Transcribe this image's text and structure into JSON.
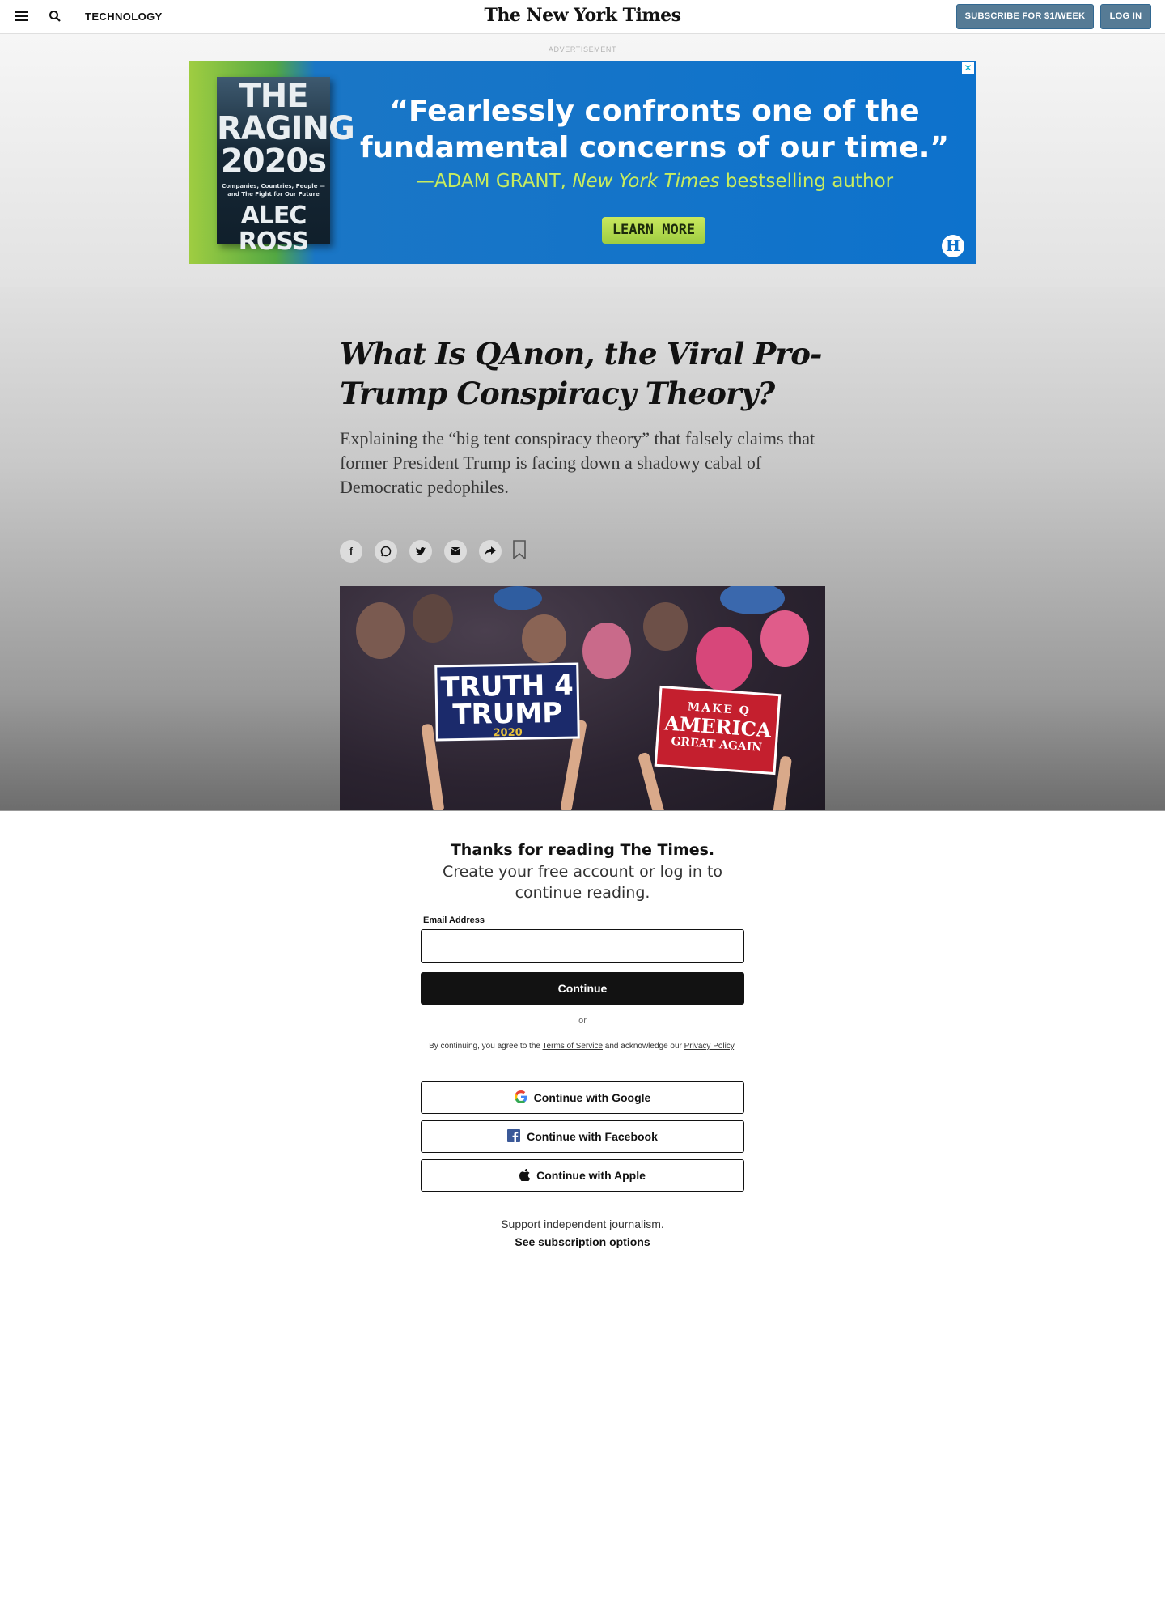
{
  "header": {
    "section": "TECHNOLOGY",
    "logo": "The New York Times",
    "subscribe_label": "SUBSCRIBE FOR $1/WEEK",
    "login_label": "LOG IN"
  },
  "ad": {
    "label": "ADVERTISEMENT",
    "book_title_1": "THE RAGING 2020s",
    "book_subtitle": "Companies, Countries, People — and The Fight for Our Future",
    "book_author": "ALEC ROSS",
    "quote": "“Fearlessly confronts one of the fundamental concerns of our time.”",
    "attribution_prefix": "—ADAM GRANT, ",
    "attribution_pub": "New York Times",
    "attribution_suffix": " bestselling author",
    "button": "LEARN MORE",
    "close": "✕",
    "publisher_mark": "H",
    "colors": {
      "blue": "#0d72cc",
      "green": "#9fcd41"
    }
  },
  "article": {
    "headline": "What Is QAnon, the Viral Pro-Trump Conspiracy Theory?",
    "summary": "Explaining the “big tent conspiracy theory” that falsely claims that former President Trump is facing down a shadowy cabal of Democratic pedophiles.",
    "share_icons": [
      "facebook-icon",
      "whatsapp-icon",
      "twitter-icon",
      "email-icon",
      "share-icon",
      "bookmark-icon"
    ],
    "photo": {
      "sign1_line1": "TRUTH 4",
      "sign1_line2": "TRUMP",
      "sign1_line3": "2020",
      "sign2_line1": "MAKE Q",
      "sign2_line2": "AMERICA",
      "sign2_line3": "GREAT AGAIN"
    }
  },
  "paywall": {
    "title": "Thanks for reading The Times.",
    "subtitle": "Create your free account or log in to continue reading.",
    "email_label": "Email Address",
    "email_value": "",
    "continue_label": "Continue",
    "or_text": "or",
    "legal_prefix": "By continuing, you agree to the ",
    "terms": "Terms of Service",
    "legal_mid": " and acknowledge our ",
    "privacy": "Privacy Policy",
    "legal_suffix": ".",
    "google_label": "Continue with Google",
    "facebook_label": "Continue with Facebook",
    "apple_label": "Continue with Apple",
    "support_text": "Support independent journalism.",
    "subscription_link": "See subscription options"
  }
}
